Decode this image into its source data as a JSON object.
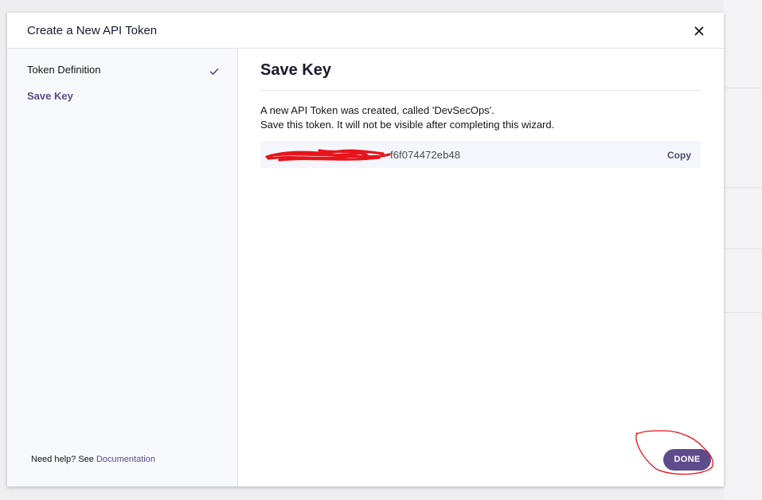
{
  "modal": {
    "title": "Create a New API Token"
  },
  "sidebar": {
    "steps": [
      {
        "label": "Token Definition",
        "completed": true
      },
      {
        "label": "Save Key",
        "active": true
      }
    ],
    "help": {
      "prefix": "Need help? See ",
      "link": "Documentation"
    }
  },
  "main": {
    "title": "Save Key",
    "message_line1": "A new API Token was created, called 'DevSecOps'.",
    "message_line2": "Save this token. It will not be visible after completing this wizard.",
    "token_visible": "f6f074472eb48",
    "copy_label": "Copy",
    "done_label": "DONE"
  },
  "icons": {
    "close": "close-icon",
    "check": "check-icon"
  },
  "colors": {
    "accent": "#5e4b8b",
    "annotation": "#e8141c"
  }
}
